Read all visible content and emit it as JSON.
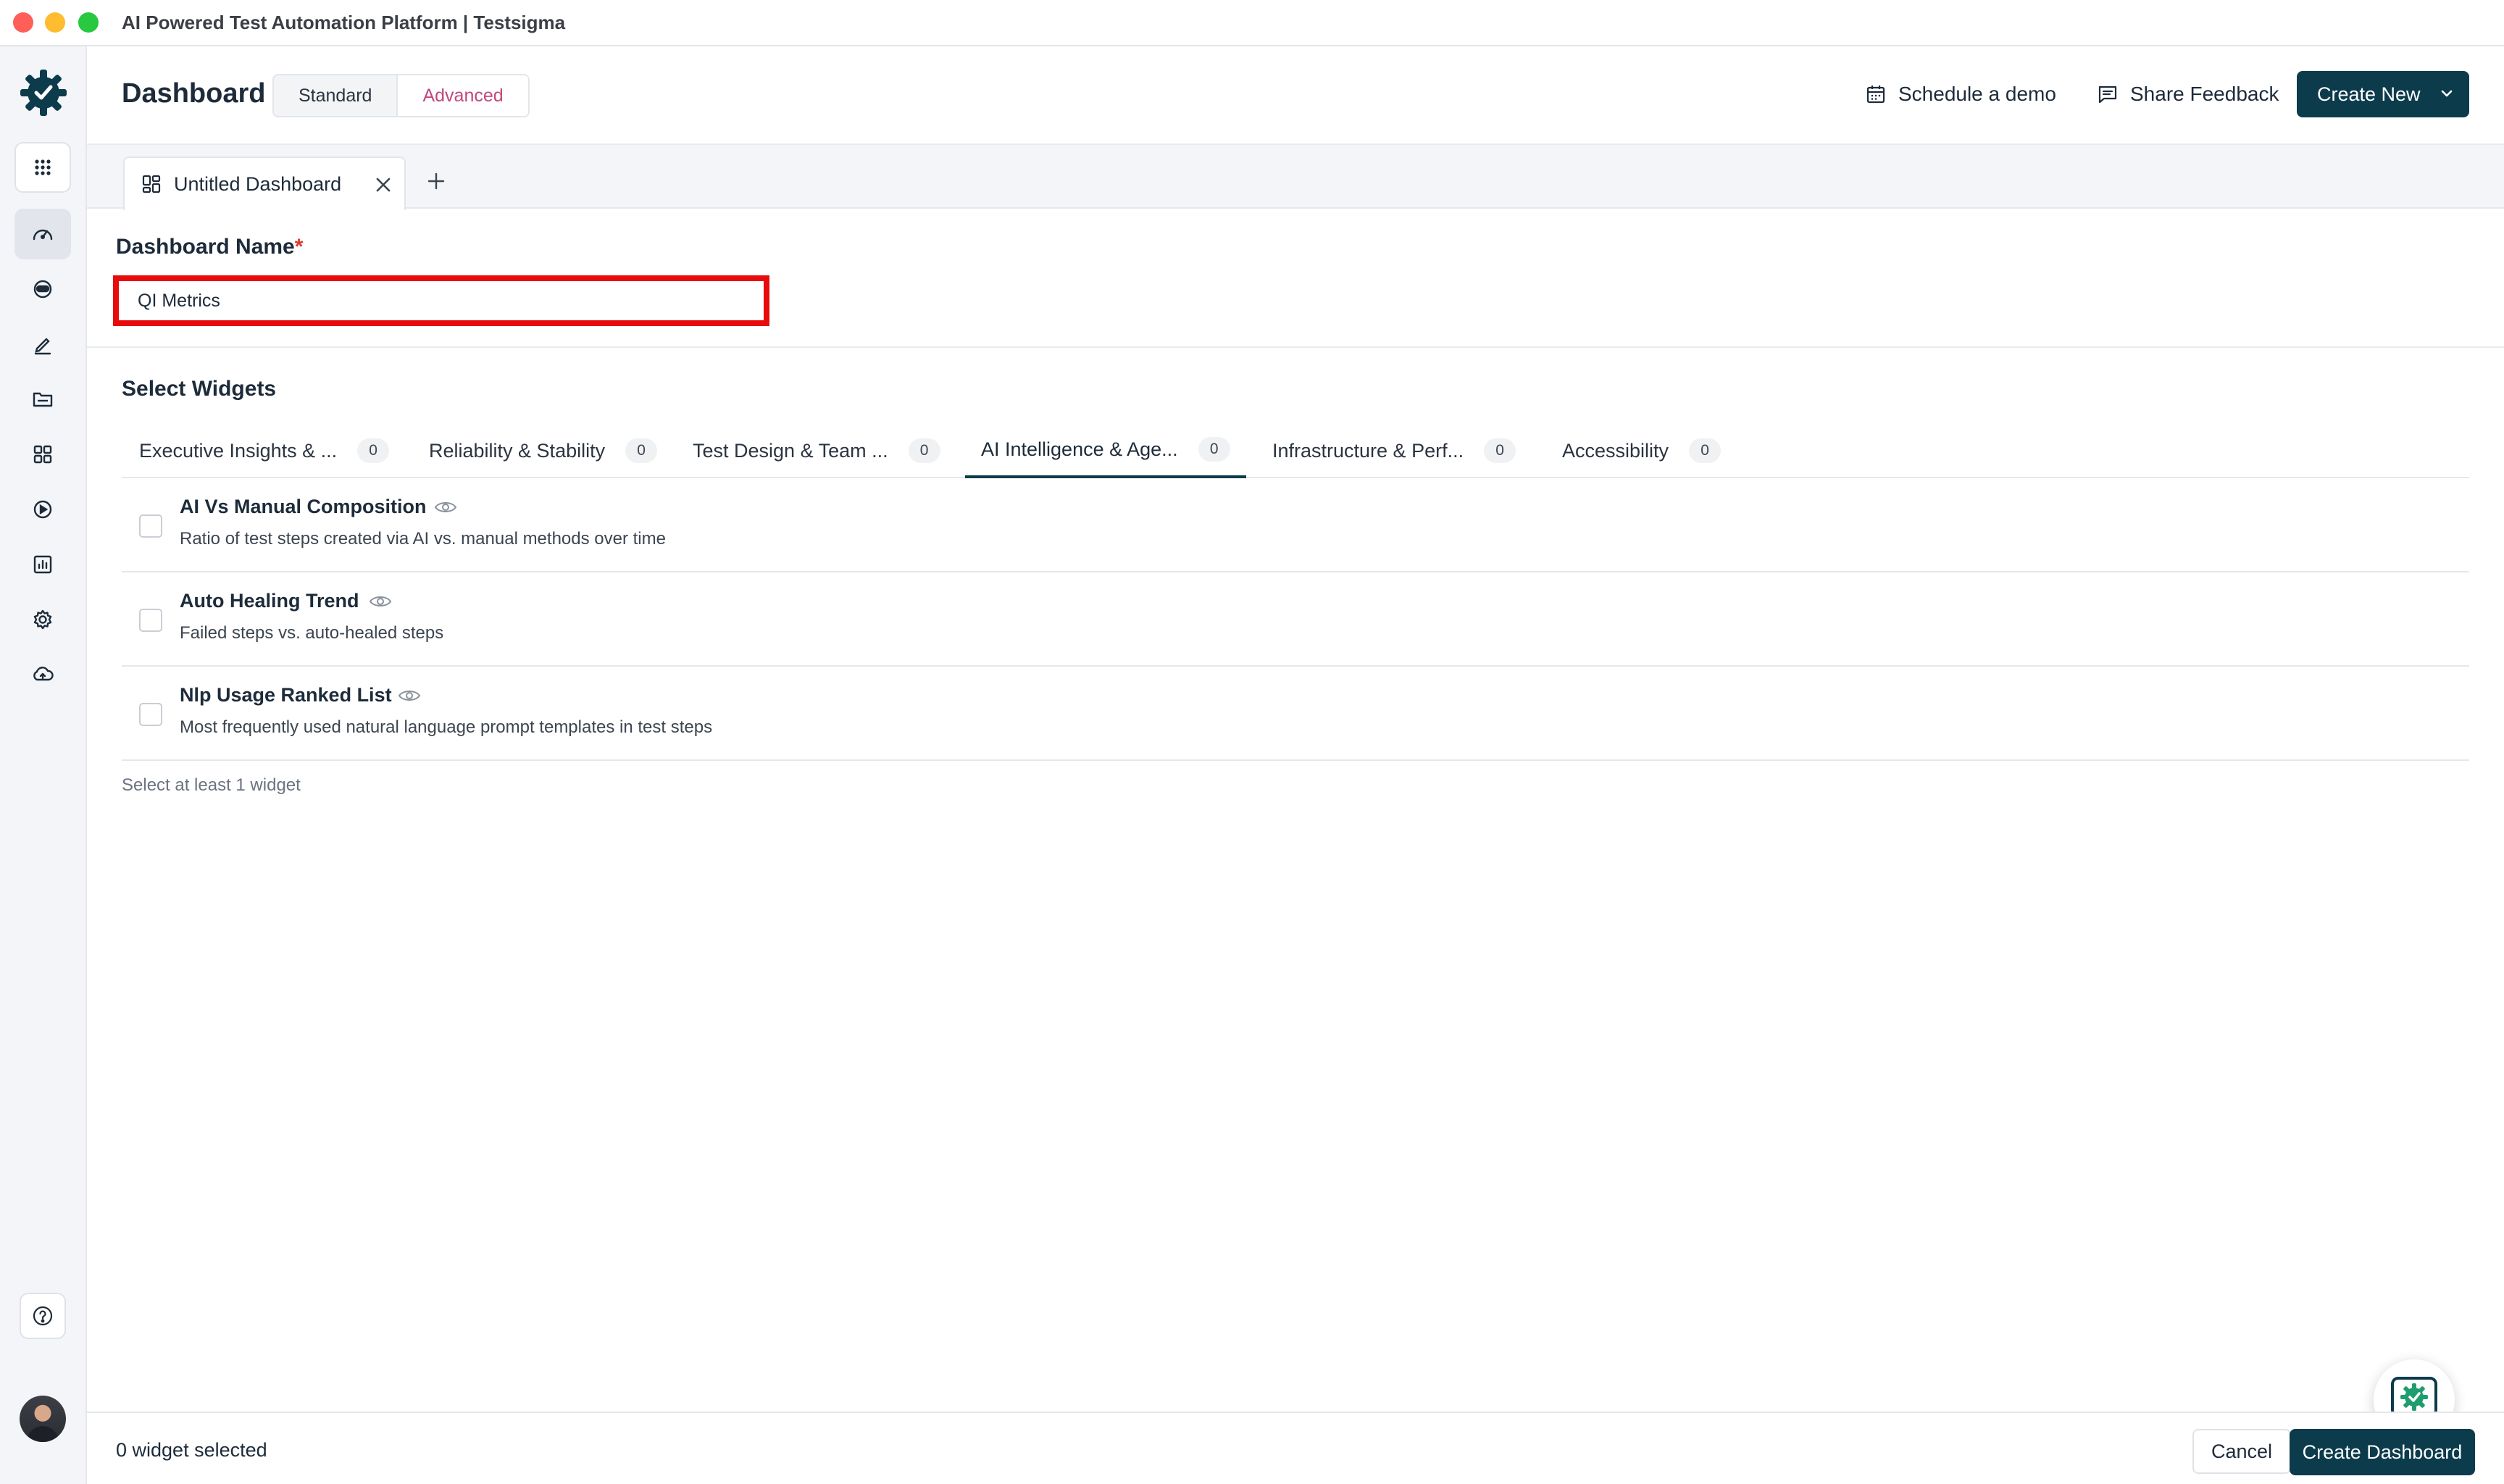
{
  "window": {
    "title": "AI Powered Test Automation Platform | Testsigma"
  },
  "sidebar": {
    "items": [
      {
        "icon": "apps-grid-icon"
      },
      {
        "icon": "dashboard-gauge-icon"
      },
      {
        "icon": "agent-icon"
      },
      {
        "icon": "edit-pencil-icon"
      },
      {
        "icon": "folder-icon"
      },
      {
        "icon": "widgets-grid-icon"
      },
      {
        "icon": "run-play-icon"
      },
      {
        "icon": "reports-chart-icon"
      },
      {
        "icon": "settings-gear-icon"
      },
      {
        "icon": "cloud-icon"
      },
      {
        "icon": "help-icon"
      }
    ]
  },
  "header": {
    "title": "Dashboard",
    "view_toggle": [
      "Standard",
      "Advanced"
    ],
    "active_view": "Advanced",
    "schedule_demo": "Schedule a demo",
    "share_feedback": "Share Feedback",
    "create_new": "Create New"
  },
  "tabs": {
    "current": "Untitled Dashboard"
  },
  "form": {
    "name_label": "Dashboard Name",
    "required_mark": "*",
    "name_value": "QI Metrics"
  },
  "widgets": {
    "section_title": "Select Widgets",
    "categories": [
      {
        "label": "Executive Insights & ...",
        "count": "0"
      },
      {
        "label": "Reliability & Stability",
        "count": "0"
      },
      {
        "label": "Test Design & Team ...",
        "count": "0"
      },
      {
        "label": "AI Intelligence & Age...",
        "count": "0"
      },
      {
        "label": "Infrastructure & Perf...",
        "count": "0"
      },
      {
        "label": "Accessibility",
        "count": "0"
      }
    ],
    "active_category": "AI Intelligence & Age...",
    "items": [
      {
        "name": "AI Vs Manual Composition",
        "description": "Ratio of test steps created via AI vs. manual methods over time"
      },
      {
        "name": "Auto Healing Trend",
        "description": "Failed steps vs. auto-healed steps"
      },
      {
        "name": "Nlp Usage Ranked List",
        "description": "Most frequently used natural language prompt templates in test steps"
      }
    ],
    "hint": "Select at least 1 widget"
  },
  "footer": {
    "selected_count": "0 widget selected",
    "cancel": "Cancel",
    "create": "Create Dashboard"
  },
  "colors": {
    "primary": "#0c3b4c",
    "accent_pink": "#c2477d",
    "highlight_red": "#e80b0b",
    "logo_green": "#1f9d6e"
  }
}
